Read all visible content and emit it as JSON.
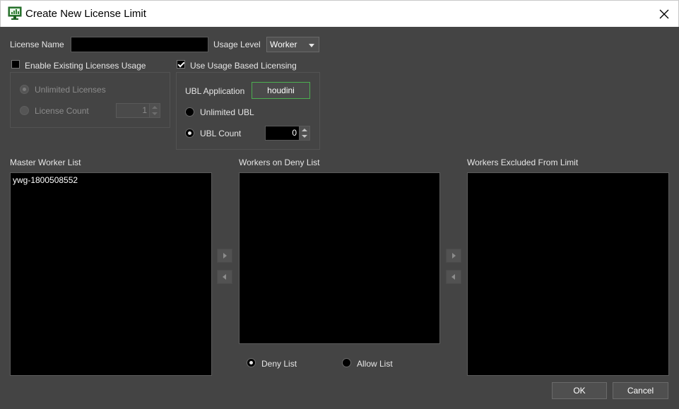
{
  "window": {
    "title": "Create New License Limit"
  },
  "license": {
    "name_label": "License Name",
    "name_value": "",
    "usage_level_label": "Usage Level",
    "usage_level_value": "Worker"
  },
  "existing": {
    "checkbox_label": "Enable Existing Licenses Usage",
    "checked": false,
    "unlimited_label": "Unlimited Licenses",
    "count_label": "License Count",
    "count_value": "1"
  },
  "ubl": {
    "checkbox_label": "Use Usage Based Licensing",
    "checked": true,
    "app_label": "UBL Application",
    "app_value": "houdini",
    "unlimited_label": "Unlimited UBL",
    "count_label": "UBL Count",
    "count_value": "0",
    "accent_color": "#4caf50"
  },
  "lists": {
    "master": {
      "label": "Master Worker List",
      "items": [
        "ywg-1800508552"
      ]
    },
    "deny": {
      "label": "Workers on Deny List",
      "items": []
    },
    "excluded": {
      "label": "Workers Excluded From Limit",
      "items": []
    }
  },
  "list_mode": {
    "deny_label": "Deny List",
    "allow_label": "Allow List",
    "selected": "deny"
  },
  "buttons": {
    "ok": "OK",
    "cancel": "Cancel"
  },
  "icons": {
    "app": "monitor-chart-icon",
    "close": "close-icon",
    "move_right": "arrow-right-icon",
    "move_left": "arrow-left-icon"
  }
}
